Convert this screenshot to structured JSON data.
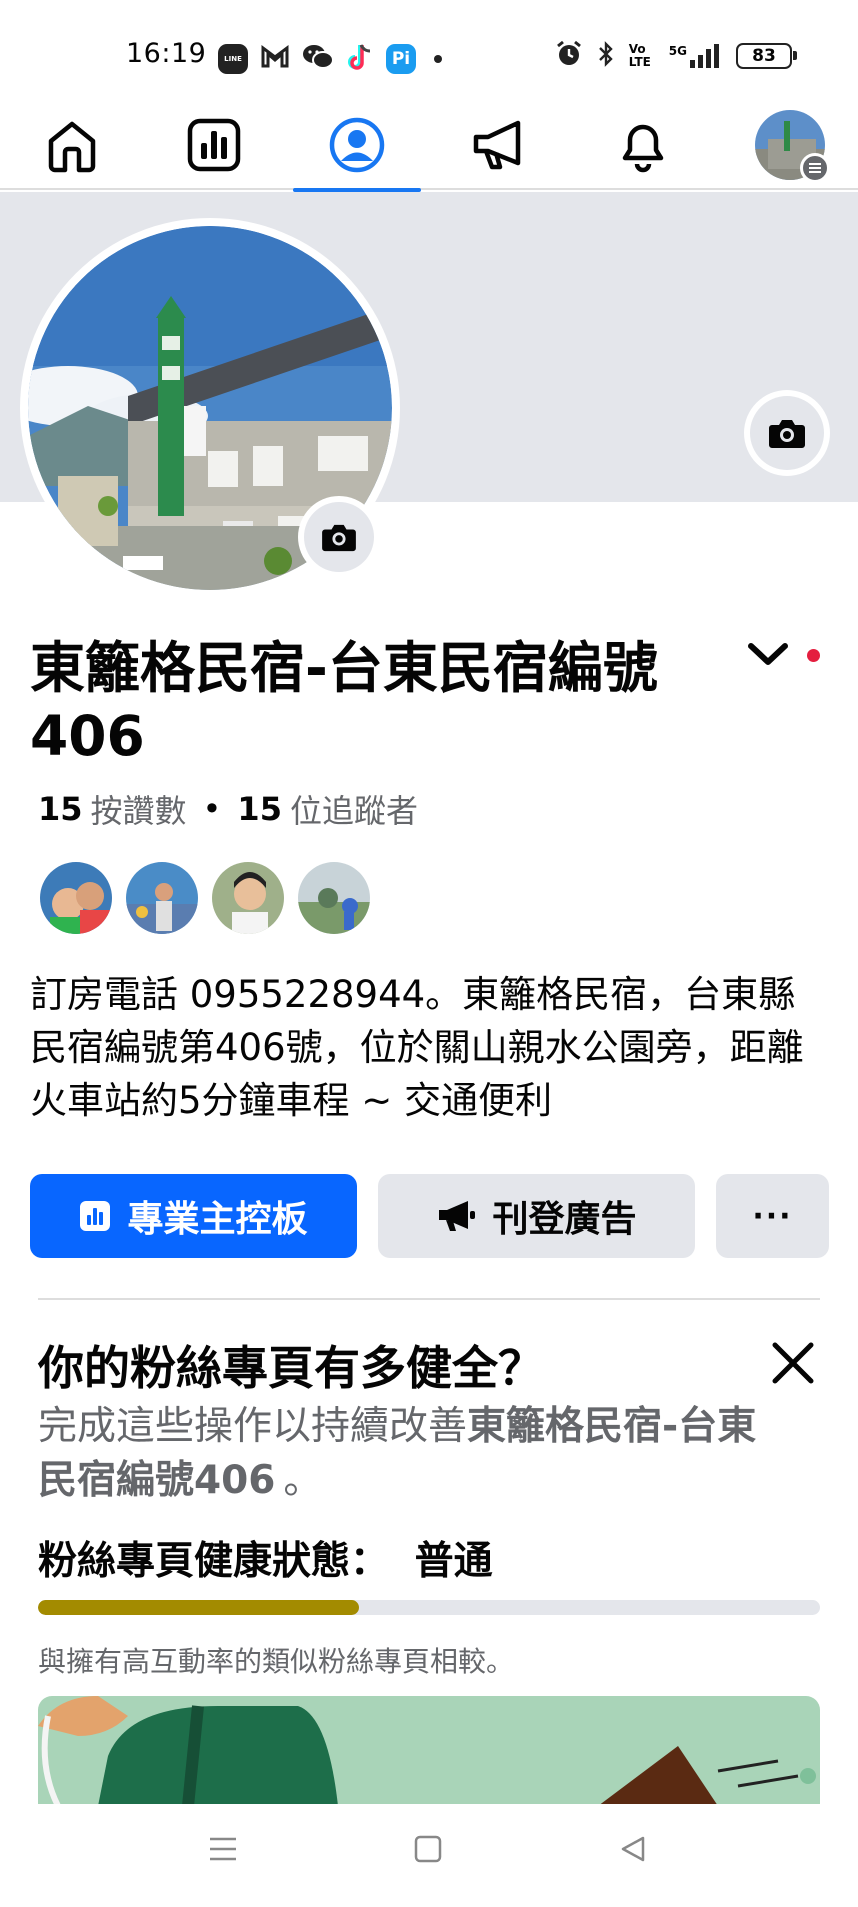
{
  "status_bar": {
    "time": "16:19",
    "apps": [
      {
        "icon": "line-icon",
        "label": "LINE",
        "color": "#222222"
      },
      {
        "icon": "gmail-icon",
        "label": "M",
        "color": "#222222"
      },
      {
        "icon": "wechat-icon",
        "label": "",
        "color": "#222222"
      },
      {
        "icon": "tiktok-icon",
        "label": "",
        "color": "#222222"
      },
      {
        "icon": "pi-icon",
        "label": "Pi",
        "color": "#1a9cf0"
      }
    ],
    "network_label": "5G",
    "volte_label": "Vo LTE",
    "battery": "83"
  },
  "nav": {
    "tabs": [
      {
        "name": "home",
        "icon": "home-icon"
      },
      {
        "name": "dashboard",
        "icon": "dashboard-icon"
      },
      {
        "name": "profile",
        "icon": "profile-icon",
        "active": true
      },
      {
        "name": "ads",
        "icon": "megaphone-icon"
      },
      {
        "name": "notifications",
        "icon": "bell-icon"
      },
      {
        "name": "account",
        "icon": "avatar"
      }
    ]
  },
  "profile": {
    "name": "東籬格民宿-台東民宿編號406",
    "likes_count": "15",
    "likes_label": "按讚數",
    "followers_count": "15",
    "followers_label": "位追蹤者",
    "bio": "訂房電話 0955228944。東籬格民宿，台東縣民宿編號第406號，位於關山親水公園旁，距離火車站約5分鐘車程 ~ 交通便利"
  },
  "actions": {
    "dashboard_label": "專業主控板",
    "advertise_label": "刊登廣告",
    "more_label": "···"
  },
  "health": {
    "title": "你的粉絲專頁有多健全？",
    "subtitle_prefix": "完成這些操作以持續改善",
    "subtitle_page": "東籬格民宿-台東民宿編號406",
    "subtitle_suffix": "。",
    "status_label": "粉絲專頁健康狀態：",
    "status_value": "普通",
    "progress_fraction": 0.41,
    "progress_color": "#a38b00",
    "compare_text": "與擁有高互動率的類似粉絲專頁相較。"
  },
  "colors": {
    "accent": "#0866ff",
    "secondary_bg": "#e4e6eb",
    "notification_dot": "#e41e3f"
  }
}
